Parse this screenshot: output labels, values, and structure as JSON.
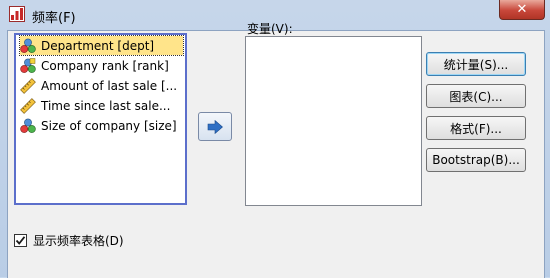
{
  "window": {
    "title": "频率(F)",
    "close_symbol": "✕"
  },
  "source_list": {
    "items": [
      {
        "label": "Department [dept]",
        "icon": "nominal-variable-icon",
        "selected": true
      },
      {
        "label": "Company rank [rank]",
        "icon": "ordinal-variable-icon",
        "selected": false
      },
      {
        "label": "Amount of last sale [...",
        "icon": "scale-variable-icon",
        "selected": false
      },
      {
        "label": "Time since last sale...",
        "icon": "scale-variable-icon",
        "selected": false
      },
      {
        "label": "Size of company [size]",
        "icon": "nominal-variable-icon",
        "selected": false
      }
    ]
  },
  "move_button": {
    "icon": "arrow-right-icon"
  },
  "variables": {
    "label": "变量(V):"
  },
  "buttons": {
    "statistics": "统计量(S)...",
    "charts": "图表(C)...",
    "format": "格式(F)...",
    "bootstrap": "Bootstrap(B)..."
  },
  "display_table": {
    "label": "显示频率表格(D)",
    "checked": true
  }
}
